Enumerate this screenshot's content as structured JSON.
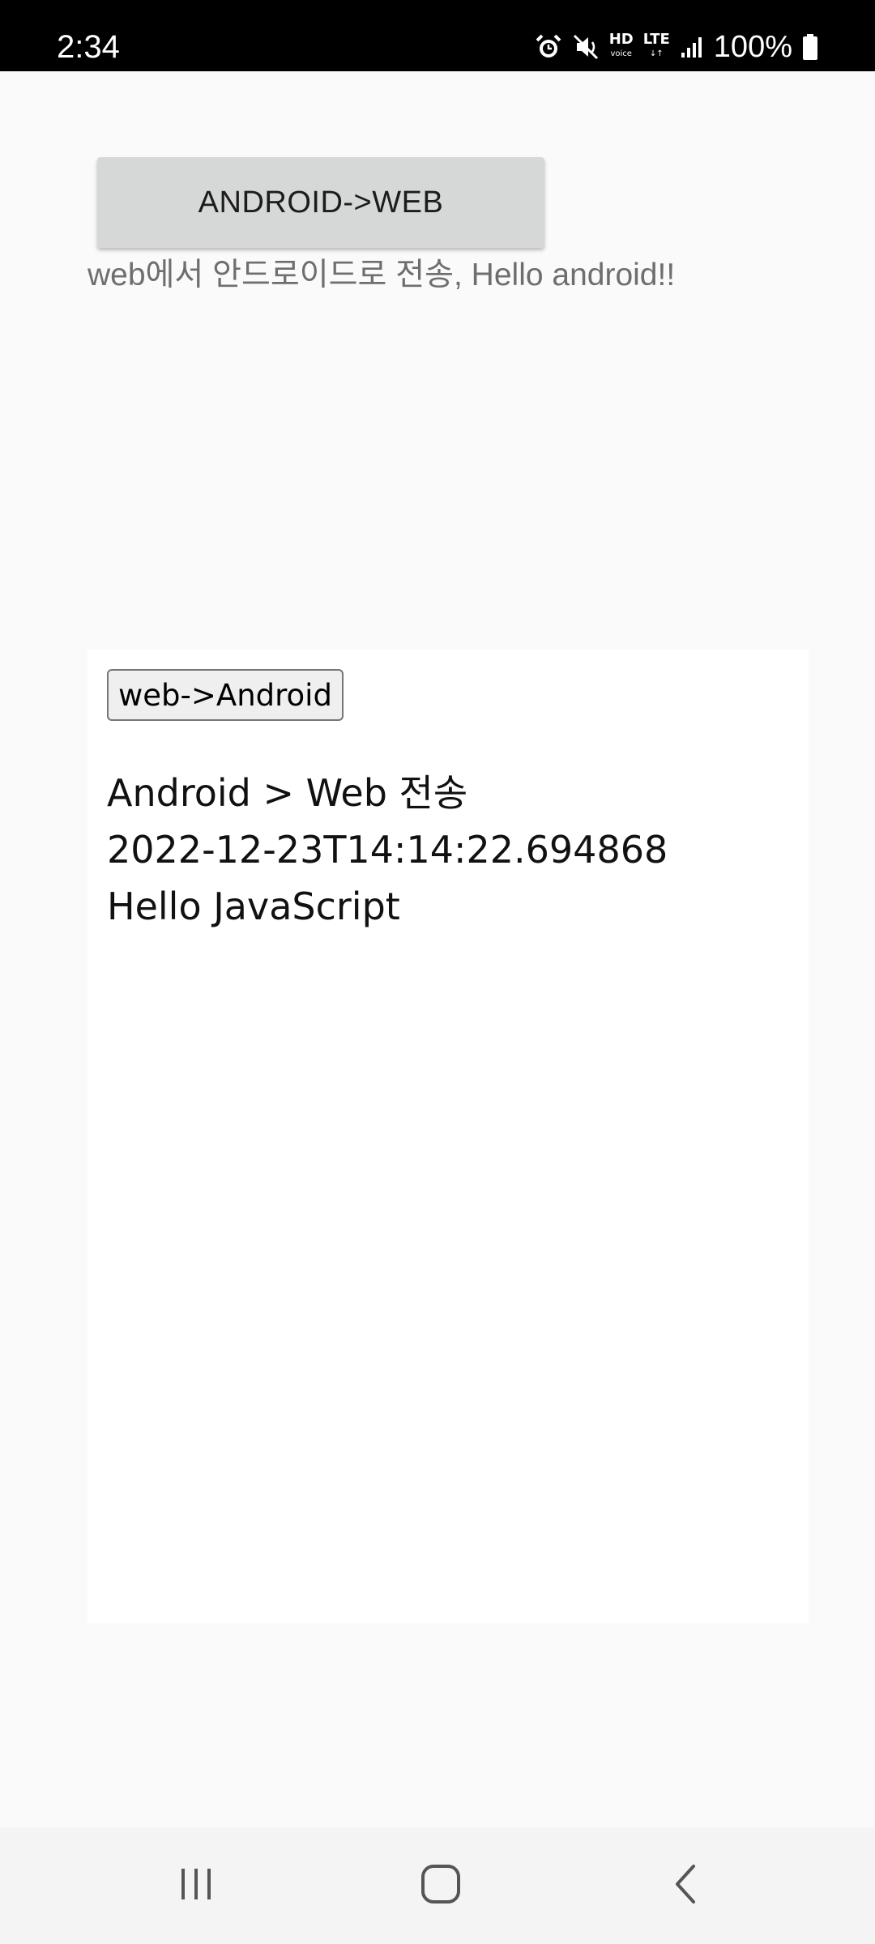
{
  "status_bar": {
    "time": "2:34",
    "network_label": "HD",
    "network_sublabel": "voice",
    "lte_label": "LTE",
    "battery_percent": "100%",
    "icons": [
      "alarm-icon",
      "mute-vibrate-icon",
      "hd-voice-icon",
      "lte-icon",
      "signal-icon",
      "battery-icon"
    ]
  },
  "app": {
    "android_button_label": "ANDROID->WEB",
    "received_message": "web에서 안드로이드로 전송, Hello android!!"
  },
  "webview": {
    "button_label": "web->Android",
    "lines": [
      "Android > Web 전송",
      "2022-12-23T14:14:22.694868",
      "Hello JavaScript"
    ]
  },
  "nav_bar": {
    "icons": [
      "recent-apps-icon",
      "home-icon",
      "back-icon"
    ]
  }
}
